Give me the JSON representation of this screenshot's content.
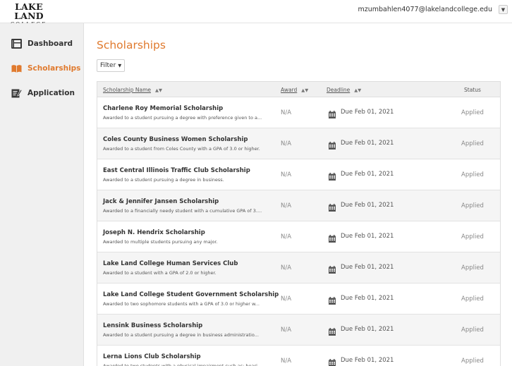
{
  "header": {
    "logo_top": "LAKE LAND",
    "logo_bottom": "COLLEGE",
    "user_email": "mzumbahlen4077@lakelandcollege.edu",
    "user_menu_icon": "caret-down-icon"
  },
  "sidebar": {
    "items": [
      {
        "label": "Dashboard",
        "icon": "dashboard-icon",
        "active": false
      },
      {
        "label": "Scholarships",
        "icon": "open-book-icon",
        "active": true
      },
      {
        "label": "Application",
        "icon": "edit-document-icon",
        "active": false
      }
    ],
    "active_color": "#e07a2e"
  },
  "main": {
    "title": "Scholarships",
    "filter_label": "Filter",
    "table": {
      "columns": {
        "name": "Scholarship Name",
        "award": "Award",
        "deadline": "Deadline",
        "status": "Status"
      },
      "rows": [
        {
          "name": "Charlene Roy Memorial Scholarship",
          "description": "Awarded to a student pursuing a degree with preference given to a...",
          "award": "N/A",
          "deadline": "Due Feb 01, 2021",
          "status": "Applied"
        },
        {
          "name": "Coles County Business Women Scholarship",
          "description": "Awarded to a student from Coles County with a GPA of 3.0 or higher.",
          "award": "N/A",
          "deadline": "Due Feb 01, 2021",
          "status": "Applied"
        },
        {
          "name": "East Central Illinois Traffic Club Scholarship",
          "description": "Awarded to a student pursuing a degree in business.",
          "award": "N/A",
          "deadline": "Due Feb 01, 2021",
          "status": "Applied"
        },
        {
          "name": "Jack & Jennifer Jansen Scholarship",
          "description": "Awarded to a financially needy student with a cumulative GPA of 3....",
          "award": "N/A",
          "deadline": "Due Feb 01, 2021",
          "status": "Applied"
        },
        {
          "name": "Joseph N. Hendrix Scholarship",
          "description": "Awarded to multiple students pursuing any major.",
          "award": "N/A",
          "deadline": "Due Feb 01, 2021",
          "status": "Applied"
        },
        {
          "name": "Lake Land College Human Services Club",
          "description": "Awarded to a student with a GPA of 2.0 or higher.",
          "award": "N/A",
          "deadline": "Due Feb 01, 2021",
          "status": "Applied"
        },
        {
          "name": "Lake Land College Student Government Scholarship",
          "description": "Awarded to two sophomore students with a GPA of 3.0 or higher w...",
          "award": "N/A",
          "deadline": "Due Feb 01, 2021",
          "status": "Applied"
        },
        {
          "name": "Lensink Business Scholarship",
          "description": "Awarded to a student pursuing a degree in business administratio...",
          "award": "N/A",
          "deadline": "Due Feb 01, 2021",
          "status": "Applied"
        },
        {
          "name": "Lerna Lions Club Scholarship",
          "description": "Awarded to two students with a physical impairment such as: heari...",
          "award": "N/A",
          "deadline": "Due Feb 01, 2021",
          "status": "Applied"
        }
      ]
    }
  }
}
